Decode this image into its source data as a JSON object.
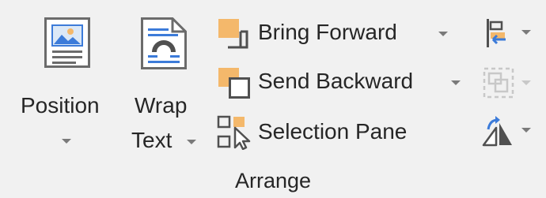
{
  "ribbon_group": {
    "name": "Arrange",
    "position": {
      "label": "Position"
    },
    "wrap_text": {
      "label_line1": "Wrap",
      "label_line2": "Text"
    },
    "bring_forward": {
      "label": "Bring Forward"
    },
    "send_backward": {
      "label": "Send Backward"
    },
    "selection_pane": {
      "label": "Selection Pane"
    },
    "align": {
      "icon": "align-objects-icon"
    },
    "group": {
      "icon": "group-objects-icon",
      "enabled": false
    },
    "rotate": {
      "icon": "rotate-objects-icon"
    }
  },
  "colors": {
    "accent_orange": "#f4b86b",
    "accent_blue": "#3c7bd9",
    "icon_gray": "#505050",
    "disabled_gray": "#c8c8c8"
  }
}
